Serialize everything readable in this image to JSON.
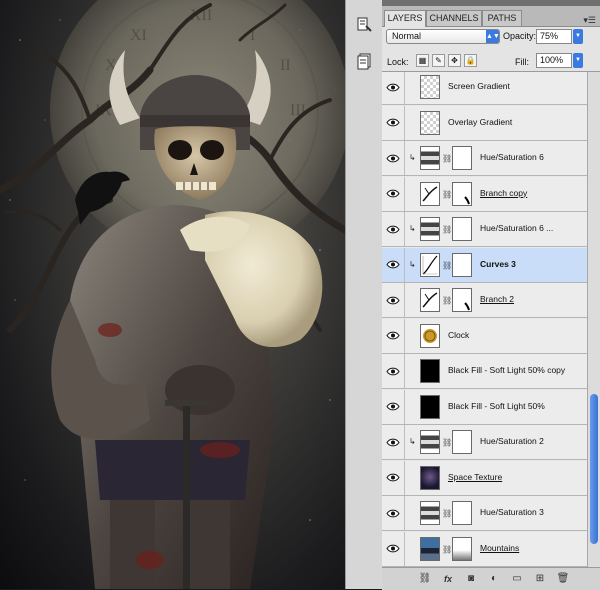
{
  "panel": {
    "tabs": [
      {
        "label": "LAYERS",
        "active": true
      },
      {
        "label": "CHANNELS",
        "active": false
      },
      {
        "label": "PATHS",
        "active": false
      }
    ],
    "blend_mode": "Normal",
    "opacity_label": "Opacity:",
    "opacity_value": "75%",
    "lock_label": "Lock:",
    "fill_label": "Fill:",
    "fill_value": "100%",
    "accent_color": "#3b7ae0",
    "selected_row_color": "#c9dcf8"
  },
  "layers": [
    {
      "name": "Screen Gradient",
      "type": "checker",
      "visible": true,
      "clipped": false,
      "mask": false
    },
    {
      "name": "Overlay Gradient",
      "type": "checker",
      "visible": true,
      "clipped": false,
      "mask": false
    },
    {
      "name": "Hue/Saturation 6",
      "type": "adjustment",
      "visible": true,
      "clipped": true,
      "mask": true
    },
    {
      "name": "Branch copy",
      "type": "branch",
      "visible": true,
      "clipped": false,
      "mask": true,
      "underline": true
    },
    {
      "name": "Hue/Saturation 6 ...",
      "type": "adjustment",
      "visible": true,
      "clipped": true,
      "mask": true
    },
    {
      "name": "Curves 3",
      "type": "curves",
      "visible": true,
      "clipped": true,
      "mask": true,
      "selected": true,
      "bold": true
    },
    {
      "name": "Branch 2",
      "type": "branch",
      "visible": true,
      "clipped": false,
      "mask": true,
      "underline": true
    },
    {
      "name": "Clock",
      "type": "clock",
      "visible": true,
      "clipped": false,
      "mask": false
    },
    {
      "name": "Black Fill - Soft Light 50% copy",
      "type": "black",
      "visible": true,
      "clipped": false,
      "mask": false
    },
    {
      "name": "Black Fill - Soft Light 50%",
      "type": "black",
      "visible": true,
      "clipped": false,
      "mask": false
    },
    {
      "name": "Hue/Saturation 2",
      "type": "adjustment",
      "visible": true,
      "clipped": true,
      "mask": true
    },
    {
      "name": "Space Texture",
      "type": "space",
      "visible": true,
      "clipped": false,
      "mask": false,
      "underline": true
    },
    {
      "name": "Hue/Saturation 3",
      "type": "adjustment",
      "visible": true,
      "clipped": false,
      "mask": true
    },
    {
      "name": "Mountains",
      "type": "mountains",
      "visible": true,
      "clipped": false,
      "mask": true,
      "underline": true
    }
  ],
  "icons": {
    "strip": [
      "history-icon",
      "actions-icon"
    ],
    "bottom": [
      "link-layers-icon",
      "fx-icon",
      "add-mask-icon",
      "adjustment-layer-icon",
      "new-group-icon",
      "new-layer-icon",
      "trash-icon"
    ],
    "bottom_glyphs": [
      "⛓",
      "fx",
      "◙",
      "◐",
      "▭",
      "⊞",
      "🗑"
    ]
  }
}
